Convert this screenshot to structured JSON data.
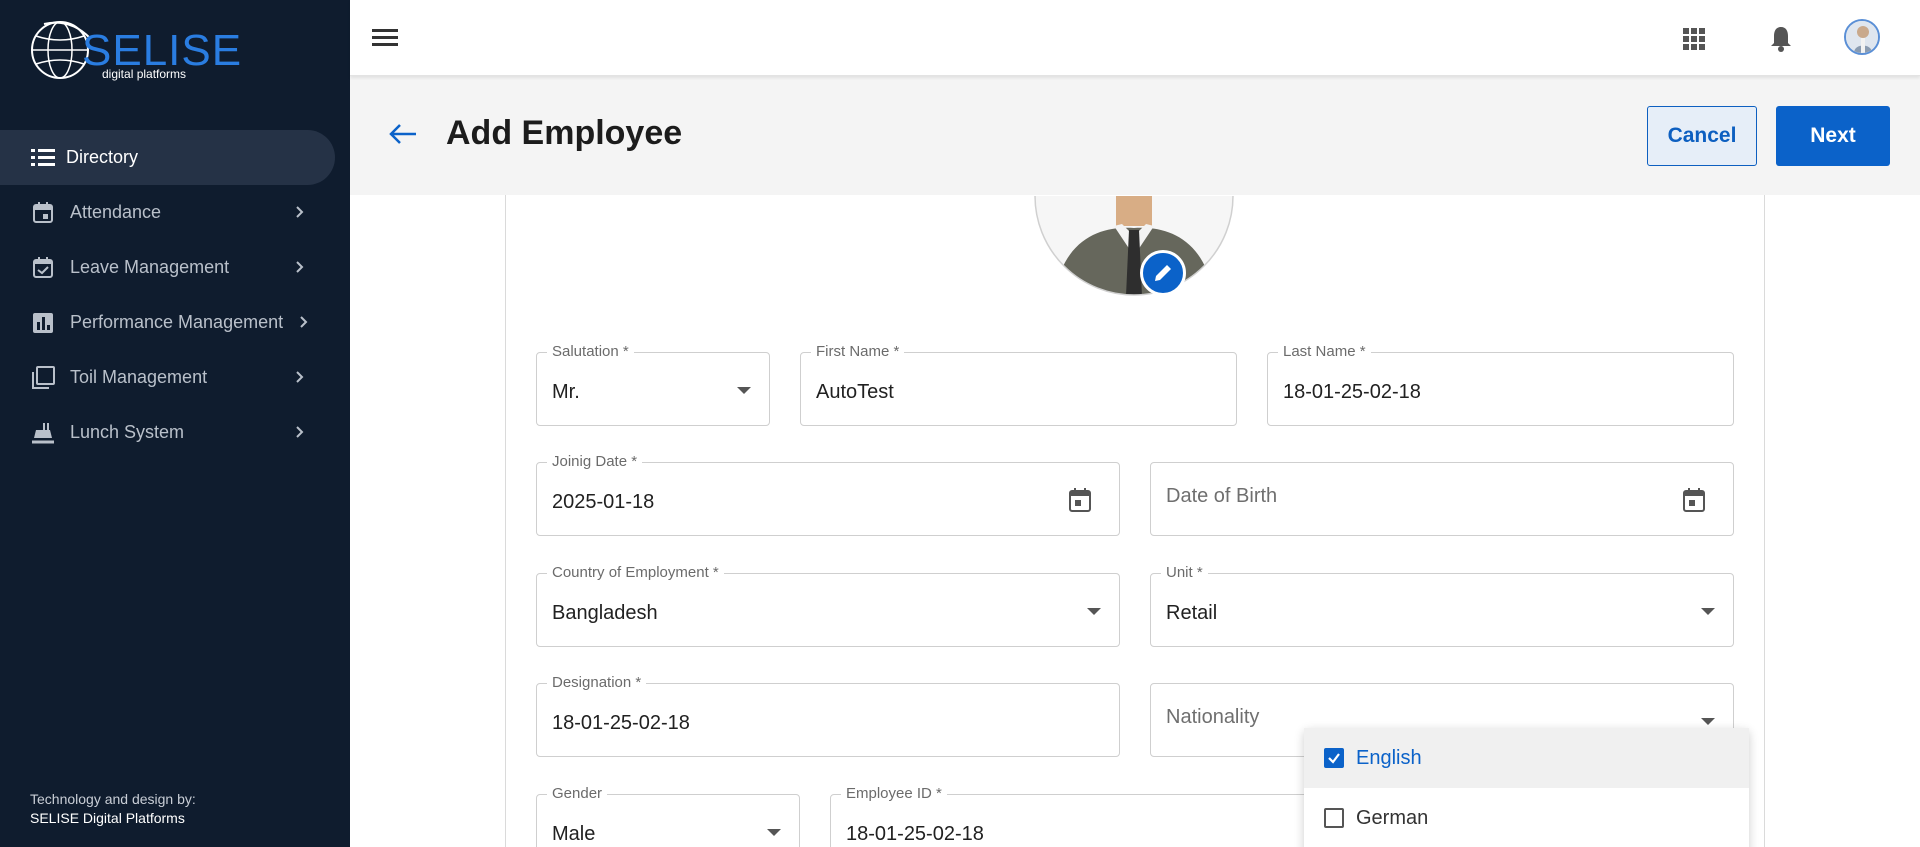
{
  "brand": {
    "logo_text": "SELISE",
    "logo_subtitle": "digital platforms",
    "accent_color": "#0b62c9"
  },
  "sidebar": {
    "items": [
      {
        "label": "Directory",
        "icon": "list-icon",
        "active": true
      },
      {
        "label": "Attendance",
        "icon": "calendar-icon",
        "active": false
      },
      {
        "label": "Leave Management",
        "icon": "calendar-check-icon",
        "active": false
      },
      {
        "label": "Performance Management",
        "icon": "bar-chart-icon",
        "active": false
      },
      {
        "label": "Toil Management",
        "icon": "copy-icon",
        "active": false
      },
      {
        "label": "Lunch System",
        "icon": "food-icon",
        "active": false
      }
    ],
    "credit_line1": "Technology and design by:",
    "credit_line2": "SELISE Digital Platforms"
  },
  "header": {
    "title": "Add Employee",
    "cancel_label": "Cancel",
    "next_label": "Next"
  },
  "form": {
    "salutation": {
      "label": "Salutation *",
      "value": "Mr."
    },
    "first_name": {
      "label": "First Name *",
      "value": "AutoTest"
    },
    "last_name": {
      "label": "Last Name *",
      "value": "18-01-25-02-18"
    },
    "joining_date": {
      "label": "Joinig Date *",
      "value": "2025-01-18"
    },
    "date_of_birth": {
      "placeholder": "Date of Birth"
    },
    "country": {
      "label": "Country of Employment *",
      "value": "Bangladesh"
    },
    "unit": {
      "label": "Unit *",
      "value": "Retail"
    },
    "designation": {
      "label": "Designation *",
      "value": "18-01-25-02-18"
    },
    "nationality": {
      "placeholder": "Nationality"
    },
    "gender": {
      "label": "Gender",
      "value": "Male"
    },
    "employee_id": {
      "label": "Employee ID *",
      "value": "18-01-25-02-18"
    }
  },
  "dropdown": {
    "options": [
      {
        "label": "English",
        "checked": true
      },
      {
        "label": "German",
        "checked": false
      }
    ]
  }
}
